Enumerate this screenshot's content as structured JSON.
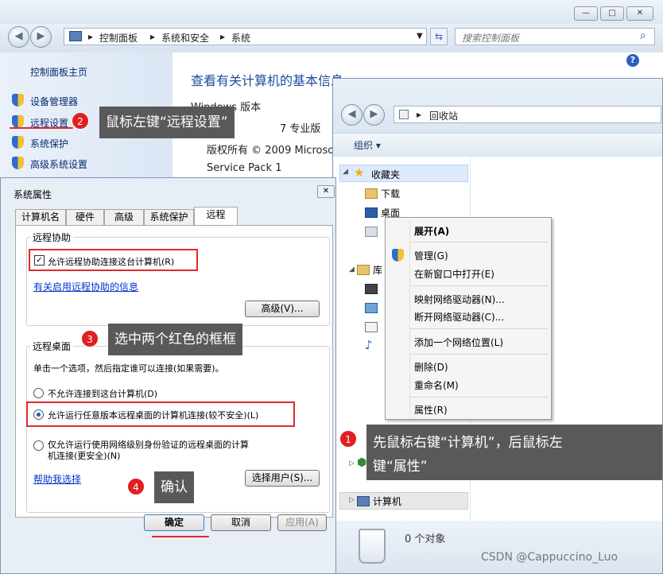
{
  "control_panel": {
    "address": [
      "控制面板",
      "系统和安全",
      "系统"
    ],
    "search_placeholder": "搜索控制面板",
    "help_label": "?",
    "window_buttons": [
      "—",
      "□",
      "✕"
    ],
    "nav_back": "◀",
    "nav_forward": "▶",
    "sidebar": {
      "home": "控制面板主页",
      "items": [
        "设备管理器",
        "远程设置",
        "系统保护",
        "高级系统设置"
      ]
    },
    "main_title": "查看有关计算机的基本信息",
    "windows_edition_label": "Windows 版本",
    "edition_fragment": "7 专业版",
    "copyright": "版权所有 © 2009 Microsoft",
    "service_pack": "Service Pack 1"
  },
  "callouts": {
    "c1": {
      "num": "1",
      "text_line1": "先鼠标右键“计算机”，后鼠标左",
      "text_line2": "键“属性”"
    },
    "c2": {
      "num": "2",
      "text": "鼠标左键“远程设置”"
    },
    "c3": {
      "num": "3",
      "text": "选中两个红色的框框"
    },
    "c4": {
      "num": "4",
      "text": "确认"
    }
  },
  "system_properties": {
    "title": "系统属性",
    "close_label": "✕",
    "tabs": [
      "计算机名",
      "硬件",
      "高级",
      "系统保护",
      "远程"
    ],
    "remote_assistance": {
      "group_label": "远程协助",
      "allow_checkbox": "允许远程协助连接这台计算机(R)",
      "checkbox_mark": "✓",
      "info_link": "有关启用远程协助的信息",
      "advanced_button": "高级(V)..."
    },
    "remote_desktop": {
      "group_label": "远程桌面",
      "instruction": "单击一个选项，然后指定谁可以连接(如果需要)。",
      "options": [
        "不允许连接到这台计算机(D)",
        "允许运行任意版本远程桌面的计算机连接(较不安全)(L)",
        "仅允许运行使用网络级别身份验证的远程桌面的计算",
        "机连接(更安全)(N)"
      ],
      "help_link": "帮助我选择",
      "select_users_button": "选择用户(S)..."
    },
    "buttons": {
      "ok": "确定",
      "cancel": "取消",
      "apply": "应用(A)"
    }
  },
  "recycle_bin": {
    "address": "回收站",
    "organize": "组织 ▾",
    "nav_items": {
      "favorites": "收藏夹",
      "downloads": "下载",
      "desktop": "桌面",
      "libraries": "库",
      "homegroup": "家",
      "computer": "计算机"
    },
    "status": "0 个对象"
  },
  "context_menu": {
    "items": [
      "展开(A)",
      "管理(G)",
      "在新窗口中打开(E)",
      "映射网络驱动器(N)...",
      "断开网络驱动器(C)...",
      "添加一个网络位置(L)",
      "删除(D)",
      "重命名(M)",
      "属性(R)"
    ]
  },
  "watermark": "CSDN @Cappuccino_Luo"
}
